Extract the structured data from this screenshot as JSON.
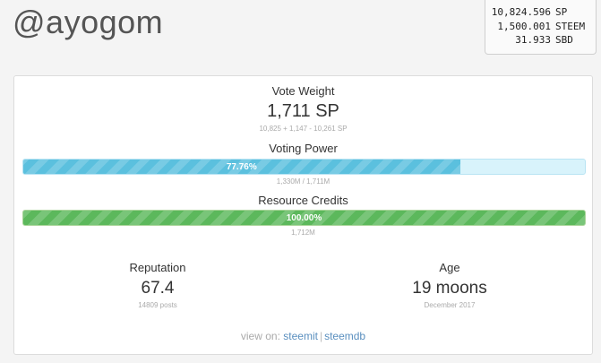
{
  "username": "@ayogom",
  "balances": [
    {
      "amount": "10,824.596",
      "unit": "SP"
    },
    {
      "amount": "1,500.001",
      "unit": "STEEM"
    },
    {
      "amount": "31.933",
      "unit": "SBD"
    }
  ],
  "vote_weight": {
    "label": "Vote Weight",
    "value": "1,711 SP",
    "detail": "10,825 + 1,147 - 10,261 SP"
  },
  "voting_power": {
    "label": "Voting Power",
    "percent_text": "77.76%",
    "percent": 77.76,
    "detail": "1,330M / 1,711M",
    "color": "#5bc0de"
  },
  "resource_credits": {
    "label": "Resource Credits",
    "percent_text": "100.00%",
    "percent": 100,
    "detail": "1,712M",
    "color": "#5cb85c"
  },
  "reputation": {
    "label": "Reputation",
    "value": "67.4",
    "detail": "14809 posts"
  },
  "age": {
    "label": "Age",
    "value": "19 moons",
    "detail": "December 2017"
  },
  "footer": {
    "prefix": "view on:",
    "links": [
      "steemit",
      "steemdb"
    ],
    "separator": "|"
  }
}
